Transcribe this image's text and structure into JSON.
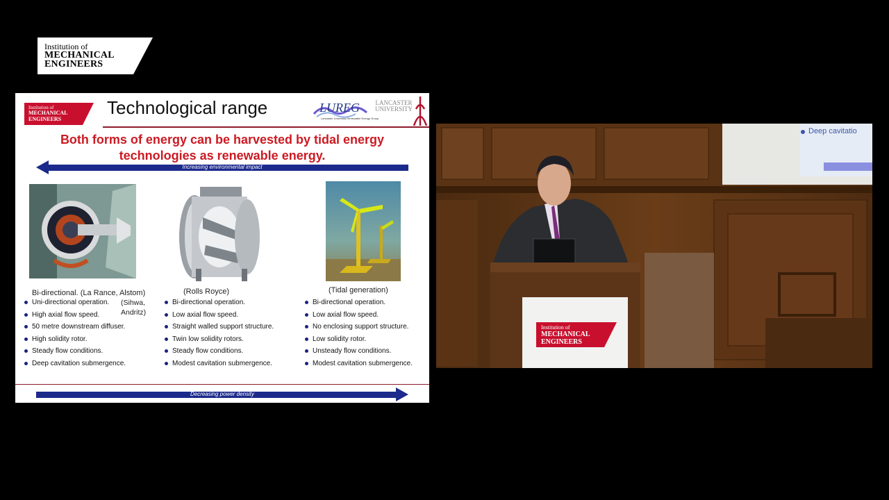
{
  "corner_logo": {
    "line1": "Institution of",
    "line2": "MECHANICAL",
    "line3": "ENGINEERS"
  },
  "slide": {
    "logo": {
      "line1": "Institution of",
      "line2": "MECHANICAL",
      "line3": "ENGINEERS"
    },
    "title": "Technological range",
    "partner_logo": {
      "name": "LUREG",
      "subtitle": "Lancaster University Renewable Energy Group"
    },
    "university_logo": {
      "line1": "LANCASTER",
      "line2": "UNIVERSITY"
    },
    "headline": {
      "line1": "Both forms of energy can be harvested by tidal energy",
      "line2": "technologies as renewable energy."
    },
    "top_arrow_label": "Increasing environmental impact",
    "bottom_arrow_label": "Decreasing power density",
    "columns": [
      {
        "caption": "Bi-directional. (La Rance, Alstom)",
        "caption_extra_1": "(Sihwa,",
        "caption_extra_2": "Andritz)",
        "bullets": [
          "Uni-directional operation.",
          "High axial flow speed.",
          "50 metre downstream diffuser.",
          "High solidity rotor.",
          "Steady flow conditions.",
          "Deep cavitation submergence."
        ]
      },
      {
        "caption": "(Rolls Royce)",
        "bullets": [
          "Bi-directional operation.",
          "Low axial flow speed.",
          "Straight walled support structure.",
          "Twin low solidity rotors.",
          "Steady flow conditions.",
          "Modest cavitation submergence."
        ]
      },
      {
        "caption": "(Tidal generation)",
        "bullets": [
          "Bi-directional operation.",
          "Low axial flow speed.",
          "No enclosing support structure.",
          "Low solidity rotor.",
          "Unsteady flow conditions.",
          "Modest cavitation submergence."
        ]
      }
    ]
  },
  "video": {
    "screen_text": "Deep cavitatio",
    "podium_logo": {
      "line1": "Institution of",
      "line2": "MECHANICAL",
      "line3": "ENGINEERS"
    }
  },
  "colors": {
    "imeche_red": "#c8102e",
    "arrow_blue": "#1c2a8c",
    "headline_red": "#cc1a22"
  }
}
